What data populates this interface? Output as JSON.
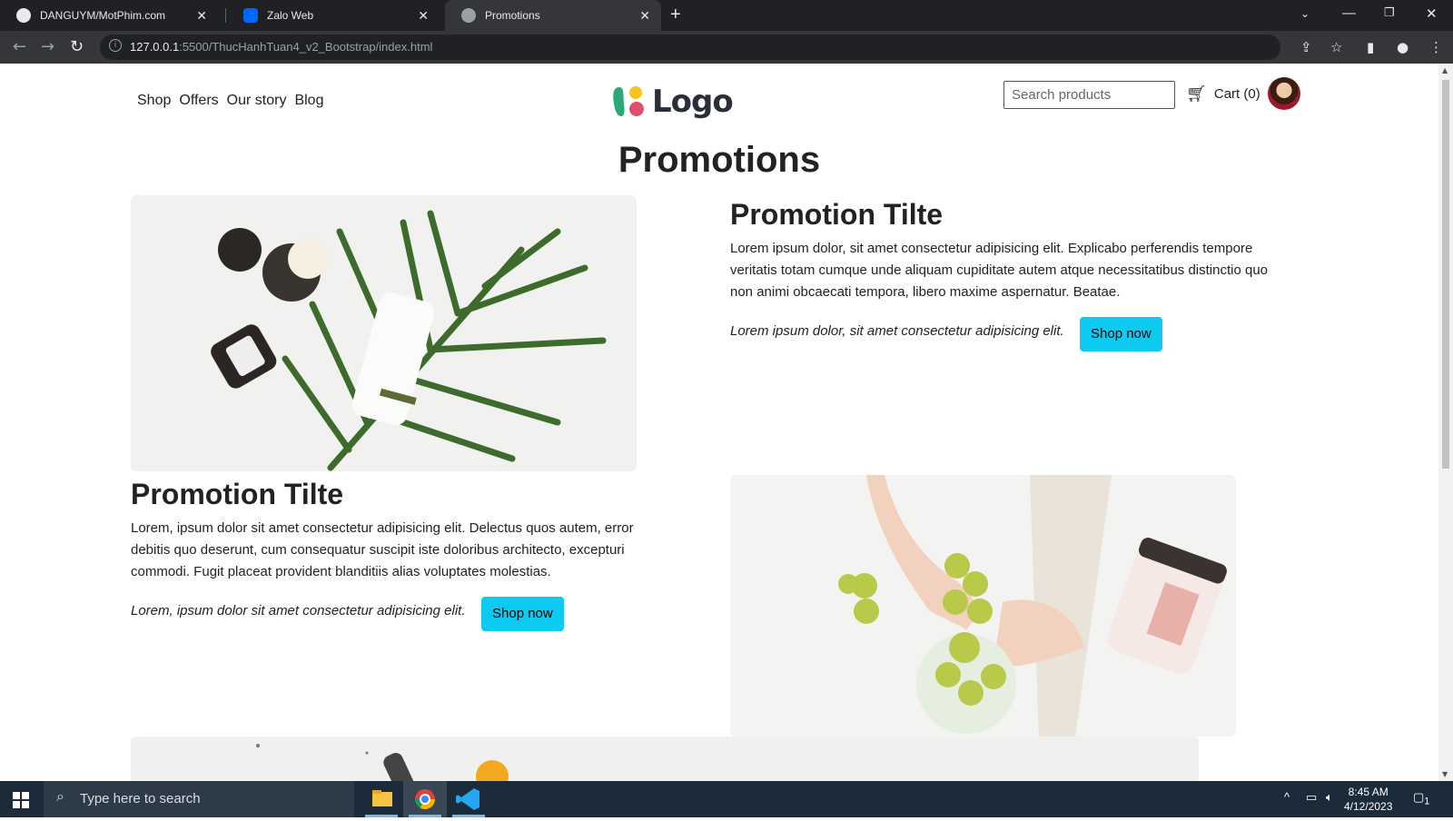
{
  "browser": {
    "tabs": [
      {
        "label": "DANGUYM/MotPhim.com",
        "icon": "github-icon"
      },
      {
        "label": "Zalo Web",
        "icon": "zalo-icon"
      },
      {
        "label": "Promotions",
        "icon": "globe-icon"
      }
    ],
    "url_host": "127.0.0.1",
    "url_rest": ":5500/ThucHanhTuan4_v2_Bootstrap/index.html"
  },
  "nav": {
    "links": [
      "Shop",
      "Offers",
      "Our story",
      "Blog"
    ],
    "logo_text": "Logo",
    "search_placeholder": "Search products",
    "cart_label": "Cart (0)"
  },
  "page_title": "Promotions",
  "promotions": [
    {
      "title": "Promotion Tilte",
      "desc": "Lorem ipsum dolor, sit amet consectetur adipisicing elit. Explicabo perferendis tempore veritatis totam cumque unde aliquam cupiditate autem atque necessitatibus distinctio quo non animi obcaecati tempora, libero maxime aspernatur. Beatae.",
      "tagline": "Lorem ipsum dolor, sit amet consectetur adipisicing elit.",
      "button": "Shop now"
    },
    {
      "title": "Promotion Tilte",
      "desc": "Lorem, ipsum dolor sit amet consectetur adipisicing elit. Delectus quos autem, error debitis quo deserunt, cum consequatur suscipit iste doloribus architecto, excepturi commodi. Fugit placeat provident blanditiis alias voluptates molestias.",
      "tagline": "Lorem, ipsum dolor sit amet consectetur adipisicing elit.",
      "button": "Shop now"
    }
  ],
  "taskbar": {
    "search_placeholder": "Type here to search",
    "time": "8:45 AM",
    "date": "4/12/2023",
    "notification_count": "1"
  },
  "colors": {
    "accent_button": "#0dcaf0",
    "chrome_dark": "#202124",
    "taskbar": "#1c2b3a"
  }
}
